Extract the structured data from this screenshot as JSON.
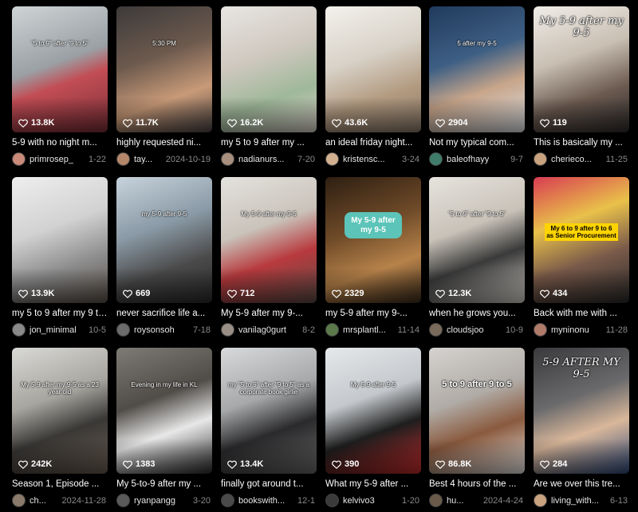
{
  "videos": [
    {
      "views": "13.8K",
      "caption": "5-9 with no night m...",
      "user": "primrosep_",
      "date": "1-22",
      "overlay": "\"5 to 9\" after \"9 to 5\"",
      "style": "plain",
      "bg": "linear-gradient(160deg,#cfd4d6 0%,#9aa0a4 45%,#c24d55 60%,#7a2f37 100%)",
      "avatar": "#c98a7a"
    },
    {
      "views": "11.7K",
      "caption": "highly requested ni...",
      "user": "tay...",
      "date": "2024-10-19",
      "overlay": "5:30 PM",
      "style": "plain",
      "bg": "linear-gradient(160deg,#3c3a3a 0%,#6d5a4e 40%,#c89a78 70%,#4a4444 100%)",
      "avatar": "#b5876a"
    },
    {
      "views": "16.2K",
      "caption": "my 5 to 9 after my ...",
      "user": "nadianurs...",
      "date": "7-20",
      "overlay": "",
      "style": "plain",
      "bg": "linear-gradient(160deg,#e8e6e2 0%,#cfc8bf 40%,#9fb89a 70%,#d9d2c8 100%)",
      "avatar": "#a88f7e"
    },
    {
      "views": "43.6K",
      "caption": "an ideal friday night...",
      "user": "kristensc...",
      "date": "3-24",
      "overlay": "",
      "style": "plain",
      "bg": "linear-gradient(160deg,#f3f1ec 0%,#d8d2c8 40%,#b29a80 70%,#8a7a6a 100%)",
      "avatar": "#d2b090"
    },
    {
      "views": "2904",
      "caption": "Not my typical com...",
      "user": "baleofhayy",
      "date": "9-7",
      "overlay": "5 after my 9-5",
      "style": "plain",
      "bg": "linear-gradient(160deg,#203a5c 0%,#3e5f84 40%,#c7a58a 65%,#dfe3e8 100%)",
      "avatar": "#3f7d6a"
    },
    {
      "views": "119",
      "caption": "This is basically my ...",
      "user": "cherieco...",
      "date": "11-25",
      "overlay": "My 5-9 after my 9-5",
      "style": "serif",
      "bg": "linear-gradient(160deg,#f0ede8 0%,#c9bfb3 40%,#6b5a50 70%,#2e2c2c 100%)",
      "avatar": "#c9a27f"
    },
    {
      "views": "13.9K",
      "caption": "my 5 to 9 after my 9 to...",
      "user": "jon_minimal",
      "date": "10-5",
      "overlay": "",
      "style": "plain",
      "bg": "linear-gradient(160deg,#eeeeee 0%,#d2d2d2 40%,#8a8a8a 70%,#5a5048 100%)",
      "avatar": "#8a8a8a"
    },
    {
      "views": "669",
      "caption": "never sacrifice life a...",
      "user": "roysonsoh",
      "date": "7-18",
      "overlay": "my 5-9 after 9-5",
      "style": "plain",
      "bg": "linear-gradient(160deg,#c7d3dc 0%,#8a9aa6 40%,#4b4a4a 70%,#2a2a2a 100%)",
      "avatar": "#6b6b6b"
    },
    {
      "views": "712",
      "caption": "My 5-9 after my 9-...",
      "user": "vanilag0gurt",
      "date": "8-2",
      "overlay": "My 5-9 after my 9-5",
      "style": "plain",
      "bg": "linear-gradient(160deg,#e4e2de 0%,#c9c3ba 40%,#b83a3e 65%,#5a4a44 100%)",
      "avatar": "#9a8f86"
    },
    {
      "views": "2329",
      "caption": "my 5-9 after my 9-...",
      "user": "mrsplantl...",
      "date": "11-14",
      "overlay": "My 5-9 after my 9-5",
      "style": "bubble",
      "bg": "linear-gradient(160deg,#2e1f12 0%,#6e4a28 40%,#b6824a 70%,#3a2a1a 100%)",
      "avatar": "#5a7a4a"
    },
    {
      "views": "12.3K",
      "caption": "when he grows you...",
      "user": "cloudsjoo",
      "date": "10-9",
      "overlay": "\"5 to 9\" after \"9 to 5\"",
      "style": "plain",
      "bg": "linear-gradient(160deg,#e6e3de 0%,#c8c2b8 40%,#3a3a3a 65%,#d8d4ce 100%)",
      "avatar": "#7a6a5a"
    },
    {
      "views": "434",
      "caption": "Back with me with ...",
      "user": "myninonu",
      "date": "11-28",
      "overlay": "My 6 to 9 after 9 to 6 as Senior Procurement",
      "style": "tag",
      "bg": "linear-gradient(160deg,#d83c52 0%,#e9c14a 35%,#7a5a4a 65%,#2a2a2a 100%)",
      "avatar": "#b07a6a"
    },
    {
      "views": "242K",
      "caption": "Season 1, Episode ...",
      "user": "ch...",
      "date": "2024-11-28",
      "overlay": "My 5-9 after my 9-5 as a 23 year old",
      "style": "plain",
      "bg": "linear-gradient(160deg,#d9d9d6 0%,#a7a59f 40%,#3a3836 65%,#6a5e52 100%)",
      "avatar": "#8a7a6a"
    },
    {
      "views": "1383",
      "caption": "My 5-to-9 after my ...",
      "user": "ryanpangg",
      "date": "3-20",
      "overlay": "Evening in my life in KL",
      "style": "plain",
      "bg": "linear-gradient(160deg,#7e7a74 0%,#504c48 40%,#e8e8e8 65%,#2a2a2a 100%)",
      "avatar": "#5a5a5a"
    },
    {
      "views": "13.4K",
      "caption": "finally got around t...",
      "user": "bookswith...",
      "date": "12-1",
      "overlay": "my \"5 to 9\" after \"9 to 5\" as a corporate book girlie",
      "style": "plain",
      "bg": "linear-gradient(160deg,#d7d9db 0%,#a6a8aa 40%,#2a2a2c 65%,#6a6a6a 100%)",
      "avatar": "#4a4a4a"
    },
    {
      "views": "390",
      "caption": "What my 5-9 after ...",
      "user": "kelvivo3",
      "date": "1-20",
      "overlay": "My 5-9 after 9-5",
      "style": "plain",
      "bg": "linear-gradient(160deg,#e6e8ea 0%,#c4c8cc 40%,#1e1e1e 65%,#c92c2c 100%)",
      "avatar": "#3a3a3a"
    },
    {
      "views": "86.8K",
      "caption": "Best 4 hours of the ...",
      "user": "hu...",
      "date": "2024-4-24",
      "overlay": "5 to 9 after 9 to 5",
      "style": "big",
      "bg": "linear-gradient(160deg,#d5d3d0 0%,#b0aba6 40%,#8a5a3e 65%,#e6e4e2 100%)",
      "avatar": "#6a5a4a"
    },
    {
      "views": "284",
      "caption": "Are we over this tre...",
      "user": "living_with...",
      "date": "6-13",
      "overlay": "5-9 AFTER MY 9-5",
      "style": "serif",
      "bg": "linear-gradient(160deg,#3a3a3c 0%,#6a6a6c 40%,#d9b79a 65%,#2f4a7a 100%)",
      "avatar": "#c9a27f"
    }
  ]
}
